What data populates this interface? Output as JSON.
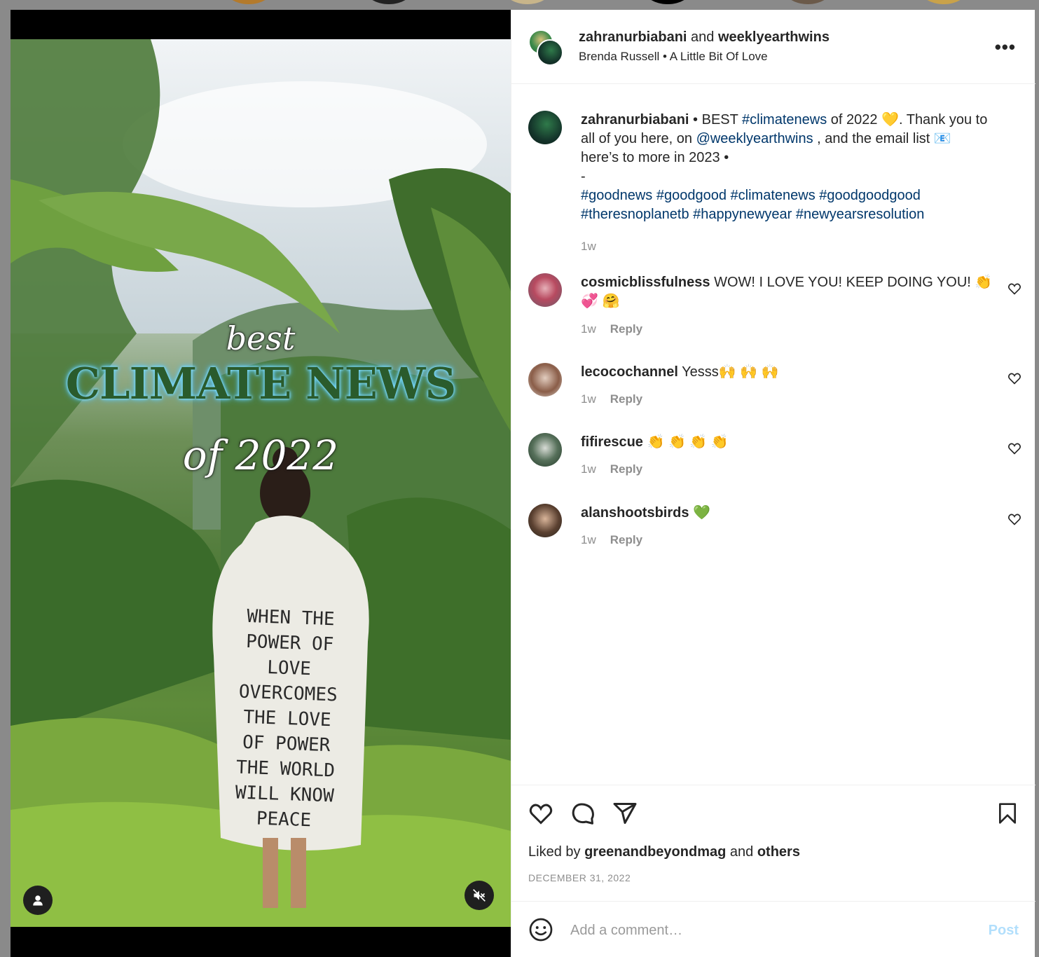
{
  "post": {
    "author": "zahranurbiabani",
    "and_text": "and",
    "collaborator": "weeklyearthwins",
    "audio_artist": "Brenda Russell",
    "audio_separator": "•",
    "audio_track": "A Little Bit Of Love",
    "more_label": "•••"
  },
  "media": {
    "overlay_best": "best",
    "overlay_title": "CLIMATE NEWS",
    "overlay_year": "of 2022",
    "shirt_text": "WHEN THE\nPOWER OF LOVE\nOVERCOMES\nTHE LOVE\nOF POWER\nTHE WORLD\nWILL KNOW\nPEACE"
  },
  "caption": {
    "username": "zahranurbiabani",
    "sep": " • ",
    "text_1": "BEST ",
    "tag_1": "#climatenews",
    "text_2": " of 2022 ",
    "emoji_1": "💛",
    "text_3": ". Thank you to all of you here, on ",
    "mention": "@weeklyearthwins",
    "text_4": " , and the email list ",
    "emoji_2": "📧",
    "text_5": "here’s to more in 2023 •",
    "dash": "-",
    "hashtags_line1": "#goodnews #goodgood #climatenews #goodgoodgood",
    "hashtags_line2": "#theresnoplanetb #happynewyear #newyearsresolution",
    "time": "1w"
  },
  "comments": [
    {
      "user": "cosmicblissfulness",
      "text": "WOW! I LOVE YOU! KEEP DOING YOU! 👏",
      "text2": "💞 🤗",
      "time": "1w",
      "reply": "Reply"
    },
    {
      "user": "lecocochannel",
      "text": "Yesss🙌 🙌 🙌",
      "time": "1w",
      "reply": "Reply"
    },
    {
      "user": "fifirescue",
      "text": "👏 👏 👏 👏",
      "time": "1w",
      "reply": "Reply"
    },
    {
      "user": "alanshootsbirds",
      "text": "💚",
      "time": "1w",
      "reply": "Reply"
    }
  ],
  "footer": {
    "liked_prefix": "Liked by ",
    "liked_user": "greenandbeyondmag",
    "liked_and": " and ",
    "liked_others": "others",
    "date": "DECEMBER 31, 2022",
    "comment_placeholder": "Add a comment…",
    "post_label": "Post"
  },
  "icons": {
    "like": "heart-icon",
    "comment": "comment-bubble-icon",
    "share": "paper-plane-icon",
    "save": "bookmark-icon",
    "emoji": "smiley-icon",
    "mute": "speaker-muted-icon",
    "tags": "person-icon"
  },
  "colors": {
    "link": "#00376b",
    "muted_text": "#8e8e8e",
    "post_button_disabled": "#b2dffc",
    "title_green": "#2a5b2c"
  }
}
